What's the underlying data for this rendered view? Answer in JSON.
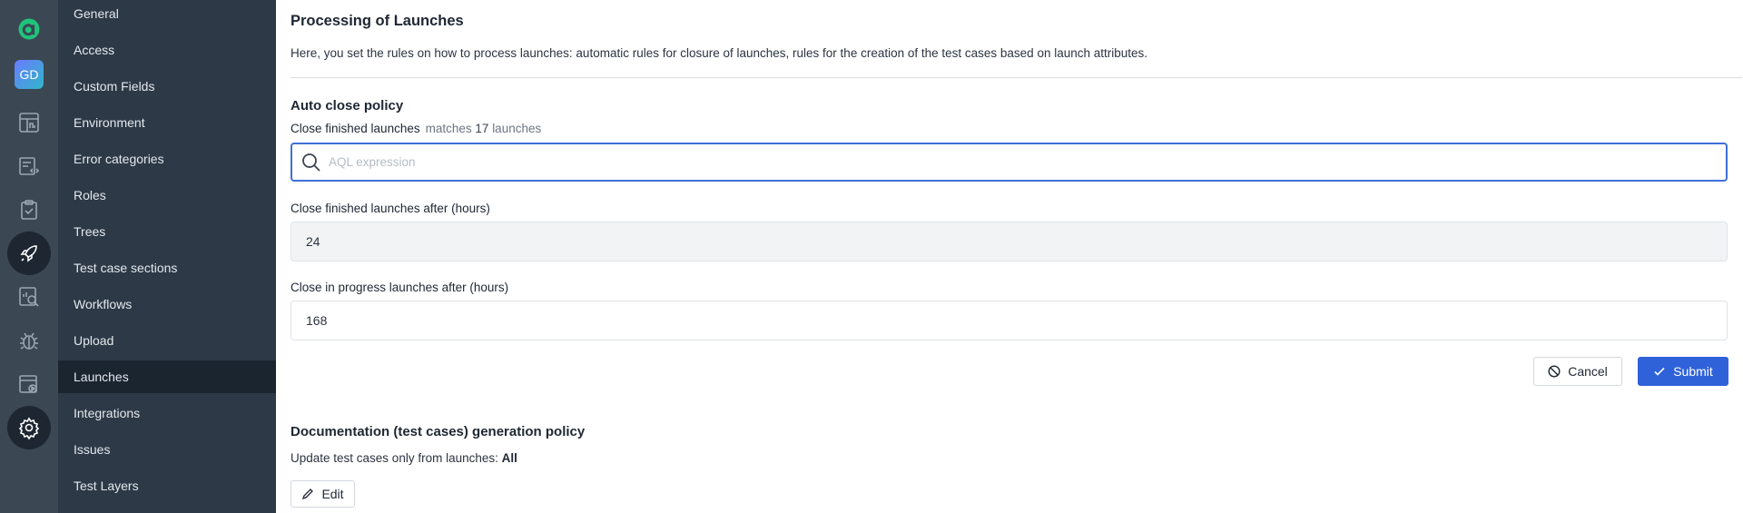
{
  "rail": {
    "avatar_initials": "GD",
    "items": [
      "dashboard-icon",
      "test-cases-icon",
      "test-plans-icon",
      "launches-icon",
      "analytics-icon",
      "defects-icon",
      "jobs-icon",
      "settings-icon"
    ],
    "active": "launches-icon",
    "active_bottom": "settings-icon"
  },
  "sidebar": {
    "items": [
      {
        "label": "General"
      },
      {
        "label": "Access"
      },
      {
        "label": "Custom Fields"
      },
      {
        "label": "Environment"
      },
      {
        "label": "Error categories"
      },
      {
        "label": "Roles"
      },
      {
        "label": "Trees"
      },
      {
        "label": "Test case sections"
      },
      {
        "label": "Workflows"
      },
      {
        "label": "Upload"
      },
      {
        "label": "Launches"
      },
      {
        "label": "Integrations"
      },
      {
        "label": "Issues"
      },
      {
        "label": "Test Layers"
      }
    ],
    "active": "Launches"
  },
  "main": {
    "title": "Processing of Launches",
    "description": "Here, you set the rules on how to process launches: automatic rules for closure of launches, rules for the creation of the test cases based on launch attributes.",
    "auto_close": {
      "heading": "Auto close policy",
      "close_finished_label": "Close finished launches",
      "matches_prefix": "matches",
      "matches_count": "17",
      "matches_suffix": "launches",
      "aql_placeholder": "AQL expression",
      "aql_value": "",
      "after_hours_label": "Close finished launches after (hours)",
      "after_hours_value": "24",
      "in_progress_label": "Close in progress launches after (hours)",
      "in_progress_value": "168",
      "cancel_label": "Cancel",
      "submit_label": "Submit"
    },
    "doc_policy": {
      "heading": "Documentation (test cases) generation policy",
      "update_text": "Update test cases only from launches:",
      "update_value": "All",
      "edit_label": "Edit"
    }
  },
  "colors": {
    "rail_bg": "#3b4753",
    "sidebar_bg": "#2d3946",
    "sidebar_active_bg": "#1b2530",
    "accent": "#2f62d9",
    "logo_green": "#1fc47a"
  }
}
